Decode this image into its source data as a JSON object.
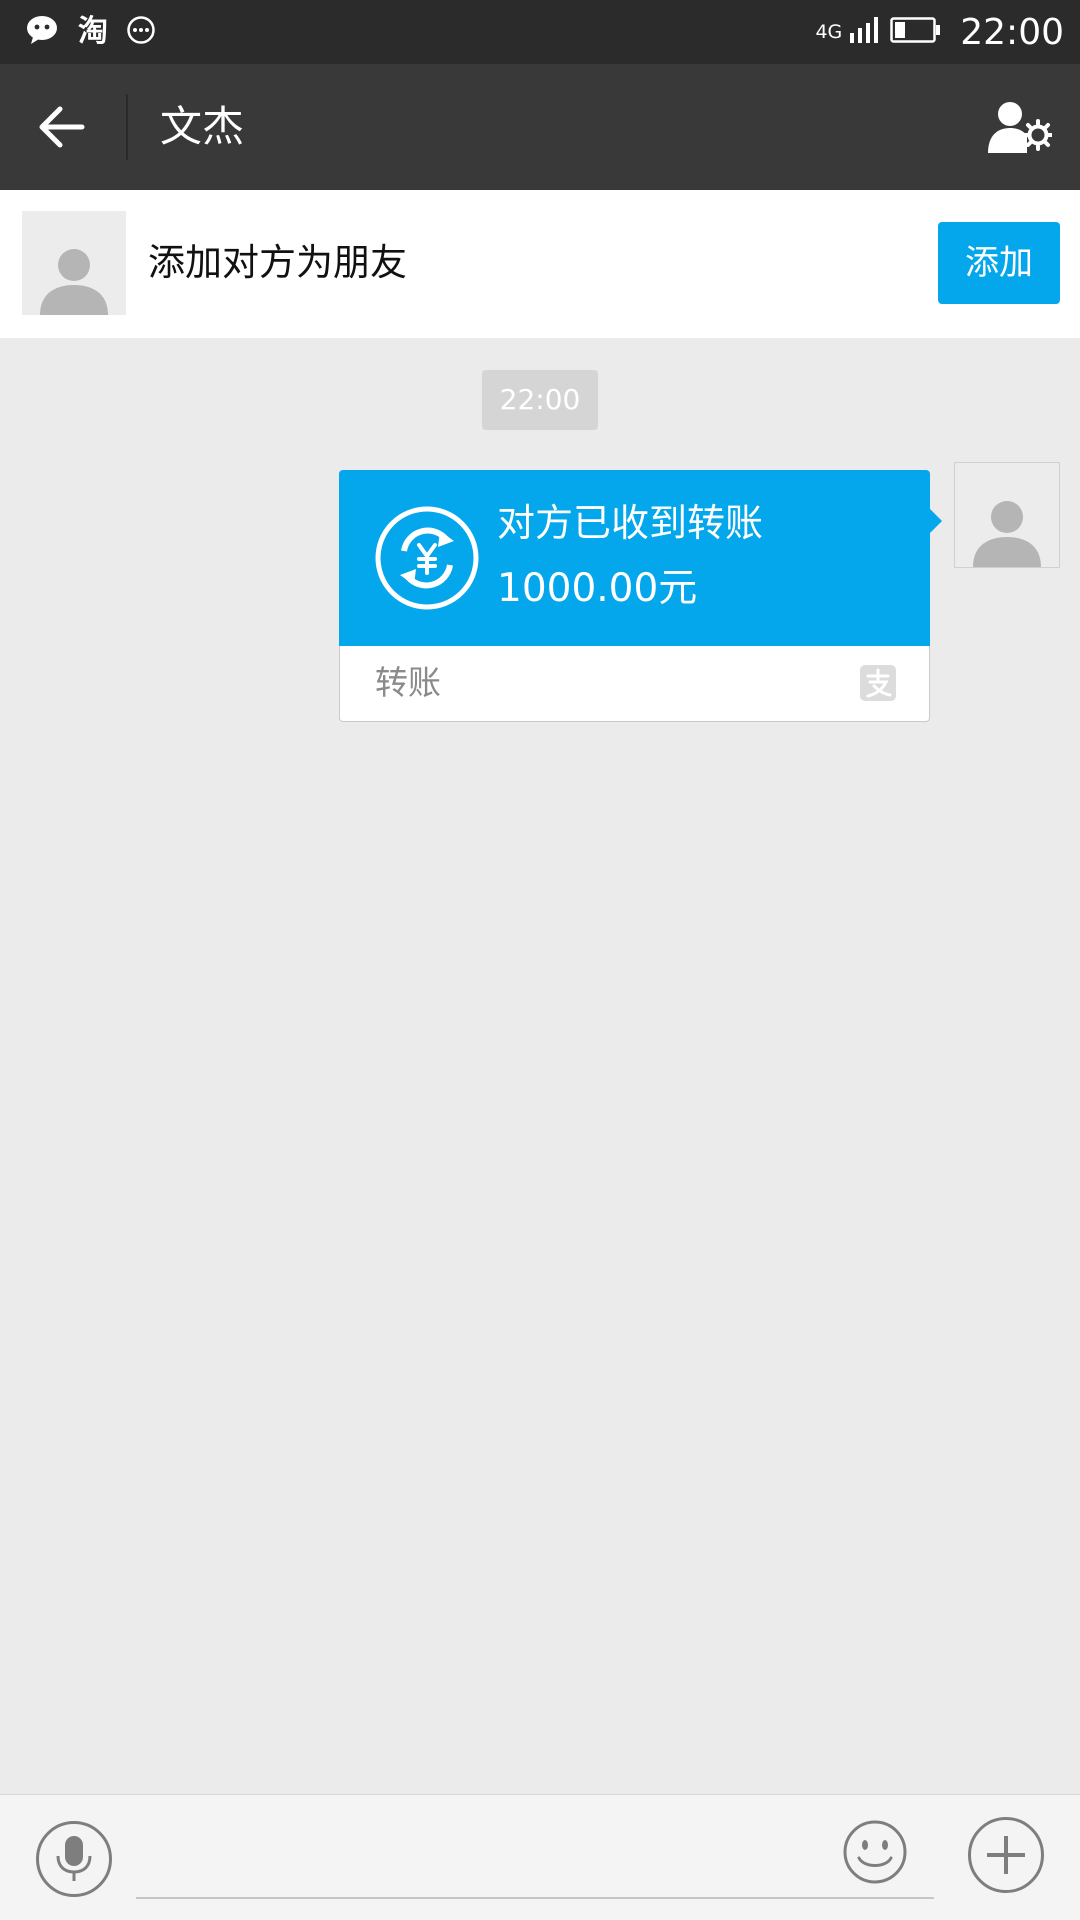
{
  "status_bar": {
    "network": "4G",
    "time": "22:00",
    "notification_icons": [
      "wechat-icon",
      "taobao-icon",
      "more-circle-icon"
    ],
    "taobao_glyph": "淘"
  },
  "title_bar": {
    "title": "文杰"
  },
  "add_friend_bar": {
    "prompt": "添加对方为朋友",
    "button_label": "添加"
  },
  "chat": {
    "timestamp": "22:00",
    "messages": [
      {
        "type": "transfer",
        "status": "对方已收到转账",
        "amount": "1000.00元",
        "footer_label": "转账"
      }
    ]
  },
  "input_bar": {
    "placeholder": ""
  },
  "colors": {
    "status_bar_bg": "#2b2b2b",
    "title_bar_bg": "#393939",
    "accent_blue": "#04a7ec",
    "chat_bg": "#ebebeb"
  }
}
